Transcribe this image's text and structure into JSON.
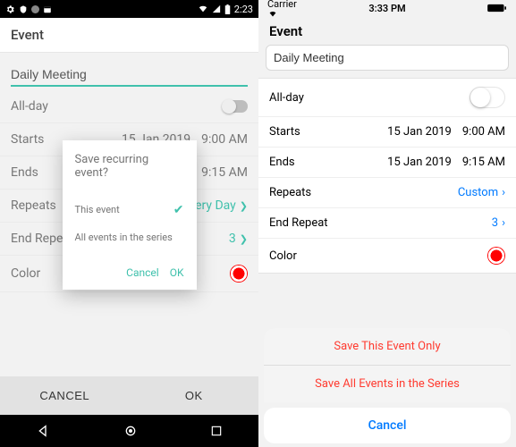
{
  "android": {
    "status": {
      "time": "2:23"
    },
    "header": "Event",
    "title_value": "Daily Meeting",
    "rows": {
      "allday": "All-day",
      "starts": {
        "label": "Starts",
        "date": "15 Jan 2019",
        "time": "9:00 AM"
      },
      "ends": {
        "label": "Ends",
        "date": "",
        "time": "9:15 AM"
      },
      "repeats": {
        "label": "Repeats",
        "value": "Every Day"
      },
      "end_repeat": {
        "label": "End Repeat",
        "value": "3"
      },
      "color": {
        "label": "Color"
      }
    },
    "footer": {
      "cancel": "CANCEL",
      "ok": "OK"
    },
    "dialog": {
      "title": "Save recurring event?",
      "option_this": "This event",
      "option_all": "All events in the series",
      "cancel": "Cancel",
      "ok": "OK"
    }
  },
  "ios": {
    "status": {
      "carrier": "Carrier",
      "time": "3:33 PM"
    },
    "header": "Event",
    "title_value": "Daily Meeting",
    "rows": {
      "allday": "All-day",
      "starts": {
        "label": "Starts",
        "date": "15 Jan 2019",
        "time": "9:00 AM"
      },
      "ends": {
        "label": "Ends",
        "date": "15 Jan 2019",
        "time": "9:15 AM"
      },
      "repeats": {
        "label": "Repeats",
        "value": "Custom"
      },
      "end_repeat": {
        "label": "End Repeat",
        "value": "3"
      },
      "color": {
        "label": "Color"
      }
    },
    "sheet": {
      "save_this": "Save This Event Only",
      "save_all": "Save All Events in the Series",
      "cancel": "Cancel"
    }
  }
}
